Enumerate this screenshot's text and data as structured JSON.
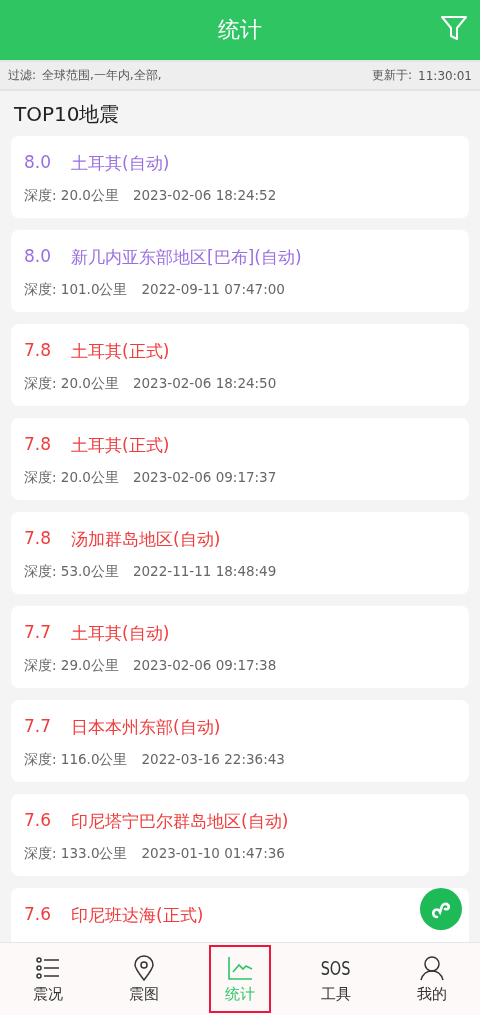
{
  "header": {
    "title": "统计"
  },
  "filter_bar": {
    "label": "过滤:",
    "value": "全球范围,一年内,全部,",
    "updated_label": "更新于:",
    "updated_time": "11:30:01"
  },
  "section_title": "TOP10地震",
  "quakes": [
    {
      "magnitude": "8.0",
      "place": "土耳其(自动)",
      "color": "#9b6ee0",
      "depth": "深度: 20.0公里",
      "time": "2023-02-06 18:24:52"
    },
    {
      "magnitude": "8.0",
      "place": "新几内亚东部地区[巴布](自动)",
      "color": "#9b6ee0",
      "depth": "深度: 101.0公里",
      "time": "2022-09-11 07:47:00"
    },
    {
      "magnitude": "7.8",
      "place": "土耳其(正式)",
      "color": "#f03c3c",
      "depth": "深度: 20.0公里",
      "time": "2023-02-06 18:24:50"
    },
    {
      "magnitude": "7.8",
      "place": "土耳其(正式)",
      "color": "#f03c3c",
      "depth": "深度: 20.0公里",
      "time": "2023-02-06 09:17:37"
    },
    {
      "magnitude": "7.8",
      "place": "汤加群岛地区(自动)",
      "color": "#f03c3c",
      "depth": "深度: 53.0公里",
      "time": "2022-11-11 18:48:49"
    },
    {
      "magnitude": "7.7",
      "place": "土耳其(自动)",
      "color": "#f03c3c",
      "depth": "深度: 29.0公里",
      "time": "2023-02-06 09:17:38"
    },
    {
      "magnitude": "7.7",
      "place": "日本本州东部(自动)",
      "color": "#f03c3c",
      "depth": "深度: 116.0公里",
      "time": "2022-03-16 22:36:43"
    },
    {
      "magnitude": "7.6",
      "place": "印尼塔宁巴尔群岛地区(自动)",
      "color": "#f03c3c",
      "depth": "深度: 133.0公里",
      "time": "2023-01-10 01:47:36"
    },
    {
      "magnitude": "7.6",
      "place": "印尼班达海(正式)",
      "color": "#f03c3c"
    }
  ],
  "tabs": [
    {
      "kind": "list",
      "label": "震况",
      "selected": false
    },
    {
      "kind": "pin",
      "label": "震图",
      "selected": false
    },
    {
      "kind": "chart",
      "label": "统计",
      "selected": true
    },
    {
      "kind": "text",
      "icon_text": "SOS",
      "label": "工具",
      "selected": false
    },
    {
      "kind": "person",
      "label": "我的",
      "selected": false
    }
  ]
}
